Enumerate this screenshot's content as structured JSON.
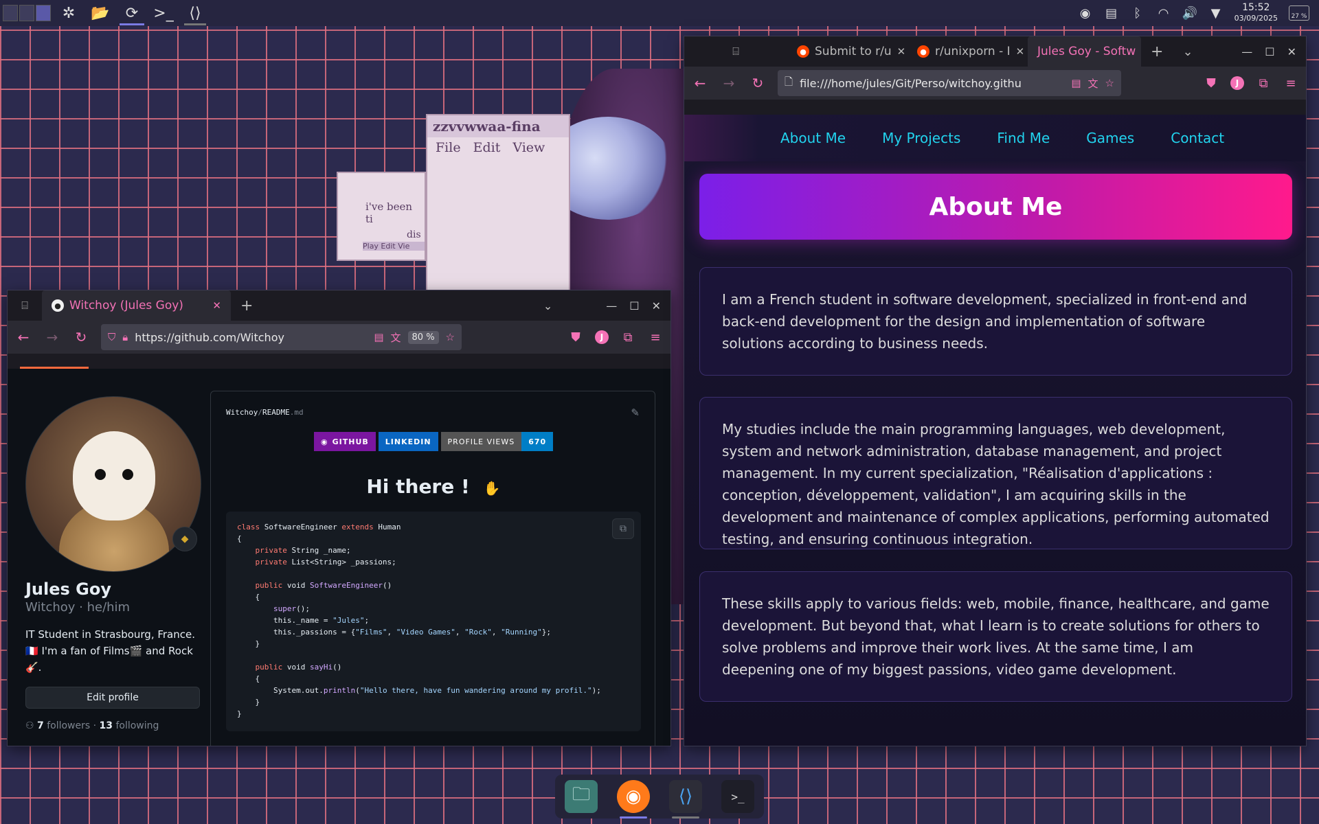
{
  "top_panel": {
    "clock_time": "15:52",
    "clock_date": "03/09/2025",
    "battery": "27 %"
  },
  "gh_window": {
    "tab_title": "Witchoy (Jules Goy)",
    "url": "https://github.com/Witchoy",
    "zoom": "80 %",
    "profile": {
      "name": "Jules Goy",
      "login": "Witchoy · he/him",
      "bio_line1": "IT Student in Strasbourg, France.",
      "bio_line2": "🇫🇷 I'm a fan of Films🎬 and Rock",
      "bio_line3": "🎸.",
      "edit_button": "Edit profile",
      "followers_count": "7",
      "followers_label": "followers",
      "separator": "·",
      "following_count": "13",
      "following_label": "following"
    },
    "readme": {
      "owner": "Witchoy",
      "sep": "/",
      "file": "README",
      "ext": ".md",
      "badge_github": "GITHUB",
      "badge_linkedin": "LINKEDIN",
      "badge_views_label": "PROFILE VIEWS",
      "badge_views_value": "670",
      "heading": "Hi there !"
    }
  },
  "site_window": {
    "tabs": [
      {
        "title": "Submit to r/u"
      },
      {
        "title": "r/unixporn - I"
      },
      {
        "title": "Jules Goy - Softw"
      }
    ],
    "url": "file:///home/jules/Git/Perso/witchoy.githu",
    "nav": [
      "About Me",
      "My Projects",
      "Find Me",
      "Games",
      "Contact"
    ],
    "banner": "About Me",
    "cards": [
      "I am a French student in software development, specialized in front-end and back-end development for the design and implementation of software solutions according to business needs.",
      "My studies include the main programming languages, web development, system and network administration, database management, and project management. In my current specialization, \"Réalisation d'applications : conception, développement, validation\", I am acquiring skills in the development and maintenance of complex applications, performing automated testing, and ensuring continuous integration.",
      "These skills apply to various fields: web, mobile, finance, healthcare, and game development. But beyond that, what I learn is to create solutions for others to solve problems and improve their work lives. At the same time, I am deepening one of my biggest passions, video game development."
    ]
  },
  "wallpaper_art": {
    "title": "zzvvwwaa-fina",
    "menu": [
      "File",
      "Edit",
      "View"
    ],
    "dialog_text": "i've been ti",
    "dialog_text2": "dis",
    "mini_menu": "Play  Edit  Vie"
  },
  "colors": {
    "accent_pink": "#f472b6",
    "nav_cyan": "#22d3ee",
    "grid_line": "#e07080",
    "banner_start": "#7b1fe8",
    "banner_end": "#ff1a8c"
  }
}
